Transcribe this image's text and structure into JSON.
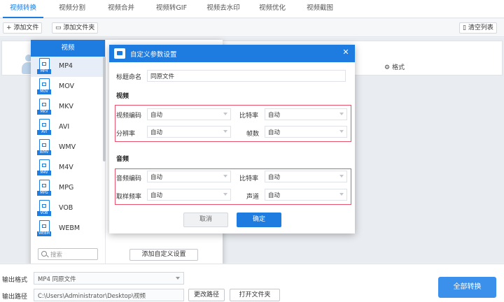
{
  "nav": {
    "tabs": [
      "视频转换",
      "视频分割",
      "视频合并",
      "视频转GIF",
      "视频去水印",
      "视频优化",
      "视频截图"
    ]
  },
  "toolbar": {
    "add_file": "添加文件",
    "add_folder": "添加文件夹",
    "clear_list": "清空列表"
  },
  "file_card": {
    "format_settings": "格式"
  },
  "format_panel": {
    "tab": "视频",
    "formats": [
      {
        "name": "MP4",
        "label": "MP4"
      },
      {
        "name": "MOV",
        "label": "MOV"
      },
      {
        "name": "MKV",
        "label": "MKV"
      },
      {
        "name": "AVI",
        "label": "AVI"
      },
      {
        "name": "WMV",
        "label": "WMV"
      },
      {
        "name": "M4V",
        "label": "M4V"
      },
      {
        "name": "MPG",
        "label": "MPG"
      },
      {
        "name": "VOB",
        "label": "VOB"
      },
      {
        "name": "WEBM",
        "label": "WEBM"
      }
    ],
    "search_placeholder": "搜索",
    "add_custom": "添加自定义设置"
  },
  "dialog": {
    "title": "自定义参数设置",
    "close": "✕",
    "title_naming_label": "标题命名",
    "title_naming_value": "同原文件",
    "video_section": "视频",
    "video_codec_label": "视频编码",
    "video_codec_value": "自动",
    "video_bitrate_label": "比特率",
    "video_bitrate_value": "自动",
    "resolution_label": "分辨率",
    "resolution_value": "自动",
    "framerate_label": "帧数",
    "framerate_value": "自动",
    "audio_section": "音频",
    "audio_codec_label": "音频编码",
    "audio_codec_value": "自动",
    "audio_bitrate_label": "比特率",
    "audio_bitrate_value": "自动",
    "samplerate_label": "取样频率",
    "samplerate_value": "自动",
    "channel_label": "声道",
    "channel_value": "自动",
    "cancel": "取消",
    "ok": "确定"
  },
  "bottom": {
    "output_format_label": "输出格式",
    "output_format_value": "MP4  同原文件",
    "output_path_label": "输出路径",
    "output_path_value": "C:\\Users\\Administrator\\Desktop\\视频",
    "change_path": "更改路径",
    "open_folder": "打开文件夹",
    "convert_all": "全部转换"
  },
  "colors": {
    "accent": "#1e7be0",
    "highlight_border": "#e8546c"
  }
}
